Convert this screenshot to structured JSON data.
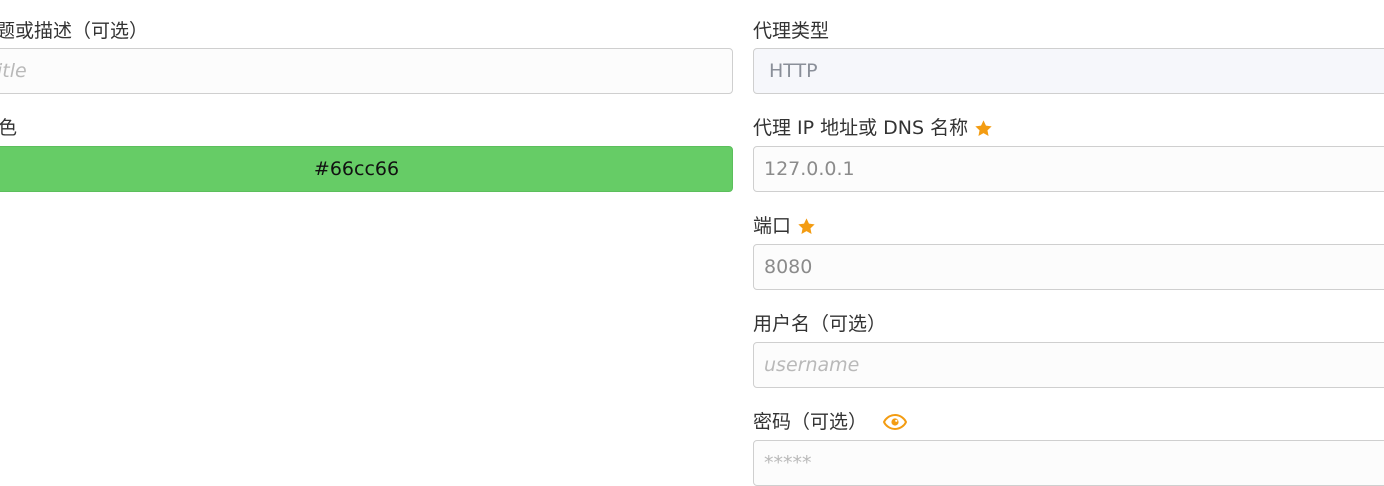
{
  "left": {
    "title_label": "题或描述（可选）",
    "title_placeholder": "itle",
    "color_label": "色",
    "color_value": "#66cc66"
  },
  "right": {
    "proxy_type_label": "代理类型",
    "proxy_type_value": "HTTP",
    "host_label": "代理 IP 地址或 DNS 名称",
    "host_placeholder": "127.0.0.1",
    "port_label": "端口",
    "port_placeholder": "8080",
    "username_label": "用户名（可选）",
    "username_placeholder": "username",
    "password_label": "密码（可选）",
    "password_placeholder": "*****"
  },
  "icons": {
    "required": "star-icon",
    "reveal_password": "eye-icon"
  },
  "colors": {
    "accent": "#f39c12",
    "swatch": "#66cc66"
  }
}
